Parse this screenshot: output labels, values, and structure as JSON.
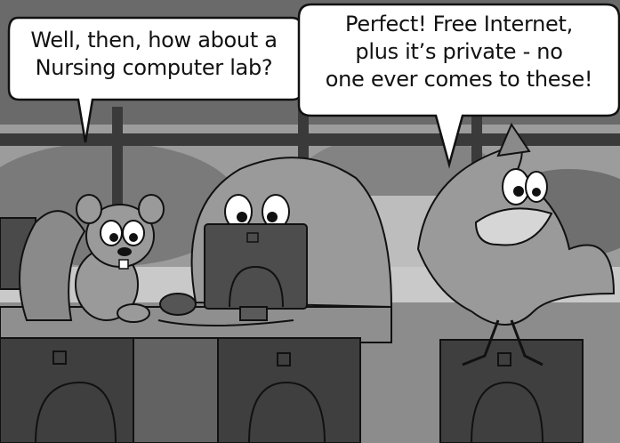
{
  "speech_bubbles": [
    {
      "speaker": "squirrel",
      "lines": [
        "Well, then, how about a",
        "Nursing computer lab?"
      ]
    },
    {
      "speaker": "bird",
      "lines": [
        "Perfect! Free Internet,",
        "plus it’s private - no",
        "one ever comes to these!"
      ]
    }
  ],
  "colors": {
    "background_window": "#6e6e6e",
    "desk": "#3d3d3d",
    "character_fill": "#9a9a9a",
    "outline": "#111111",
    "bubble": "#ffffff"
  }
}
